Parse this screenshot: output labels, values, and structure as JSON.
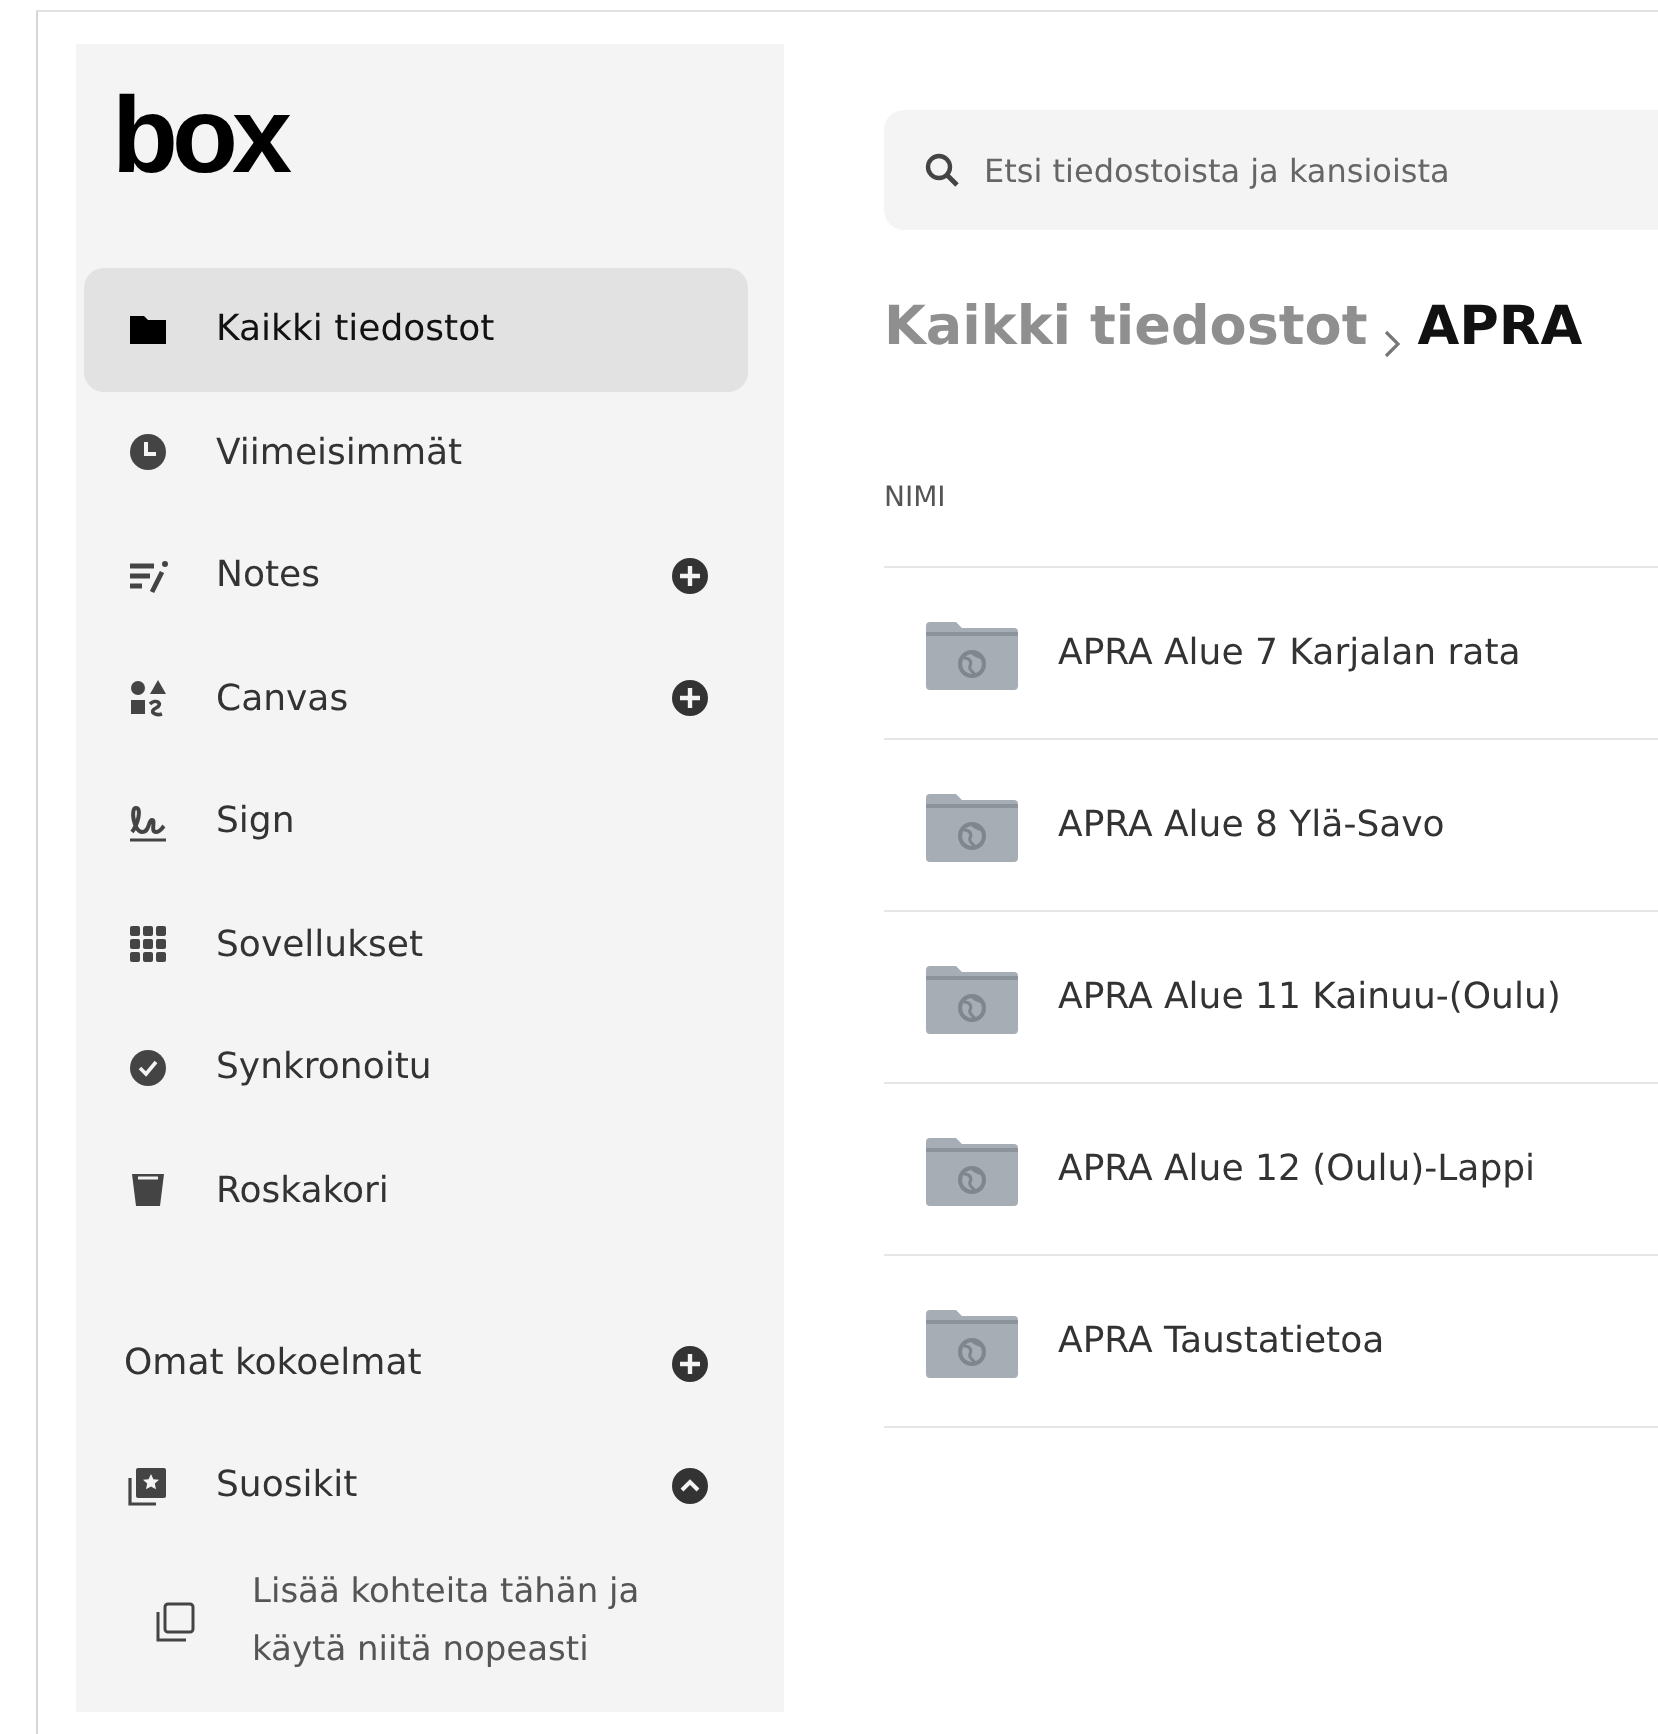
{
  "logo": "box",
  "sidebar": {
    "items": [
      {
        "label": "Kaikki tiedostot",
        "kind": "files",
        "selected": true,
        "add": false
      },
      {
        "label": "Viimeisimmät",
        "kind": "recent",
        "selected": false,
        "add": false
      },
      {
        "label": "Notes",
        "kind": "notes",
        "selected": false,
        "add": true
      },
      {
        "label": "Canvas",
        "kind": "canvas",
        "selected": false,
        "add": true
      },
      {
        "label": "Sign",
        "kind": "sign",
        "selected": false,
        "add": false
      },
      {
        "label": "Sovellukset",
        "kind": "apps",
        "selected": false,
        "add": false
      },
      {
        "label": "Synkronoitu",
        "kind": "synced",
        "selected": false,
        "add": false
      },
      {
        "label": "Roskakori",
        "kind": "trash",
        "selected": false,
        "add": false
      }
    ],
    "collections": {
      "label": "Omat kokoelmat"
    },
    "favorites": {
      "label": "Suosikit",
      "expanded": true,
      "hint": "Lisää kohteita tähän ja käytä niitä nopeasti"
    }
  },
  "search": {
    "placeholder": "Etsi tiedostoista ja kansioista"
  },
  "breadcrumb": [
    "Kaikki tiedostot",
    "APRA"
  ],
  "table": {
    "columns": [
      "NIMI"
    ],
    "rows": [
      {
        "name": "APRA Alue 7 Karjalan rata"
      },
      {
        "name": "APRA Alue 8 Ylä-Savo"
      },
      {
        "name": "APRA Alue 11 Kainuu-(Oulu)"
      },
      {
        "name": "APRA Alue 12 (Oulu)-Lappi"
      },
      {
        "name": "APRA Taustatietoa"
      }
    ]
  }
}
